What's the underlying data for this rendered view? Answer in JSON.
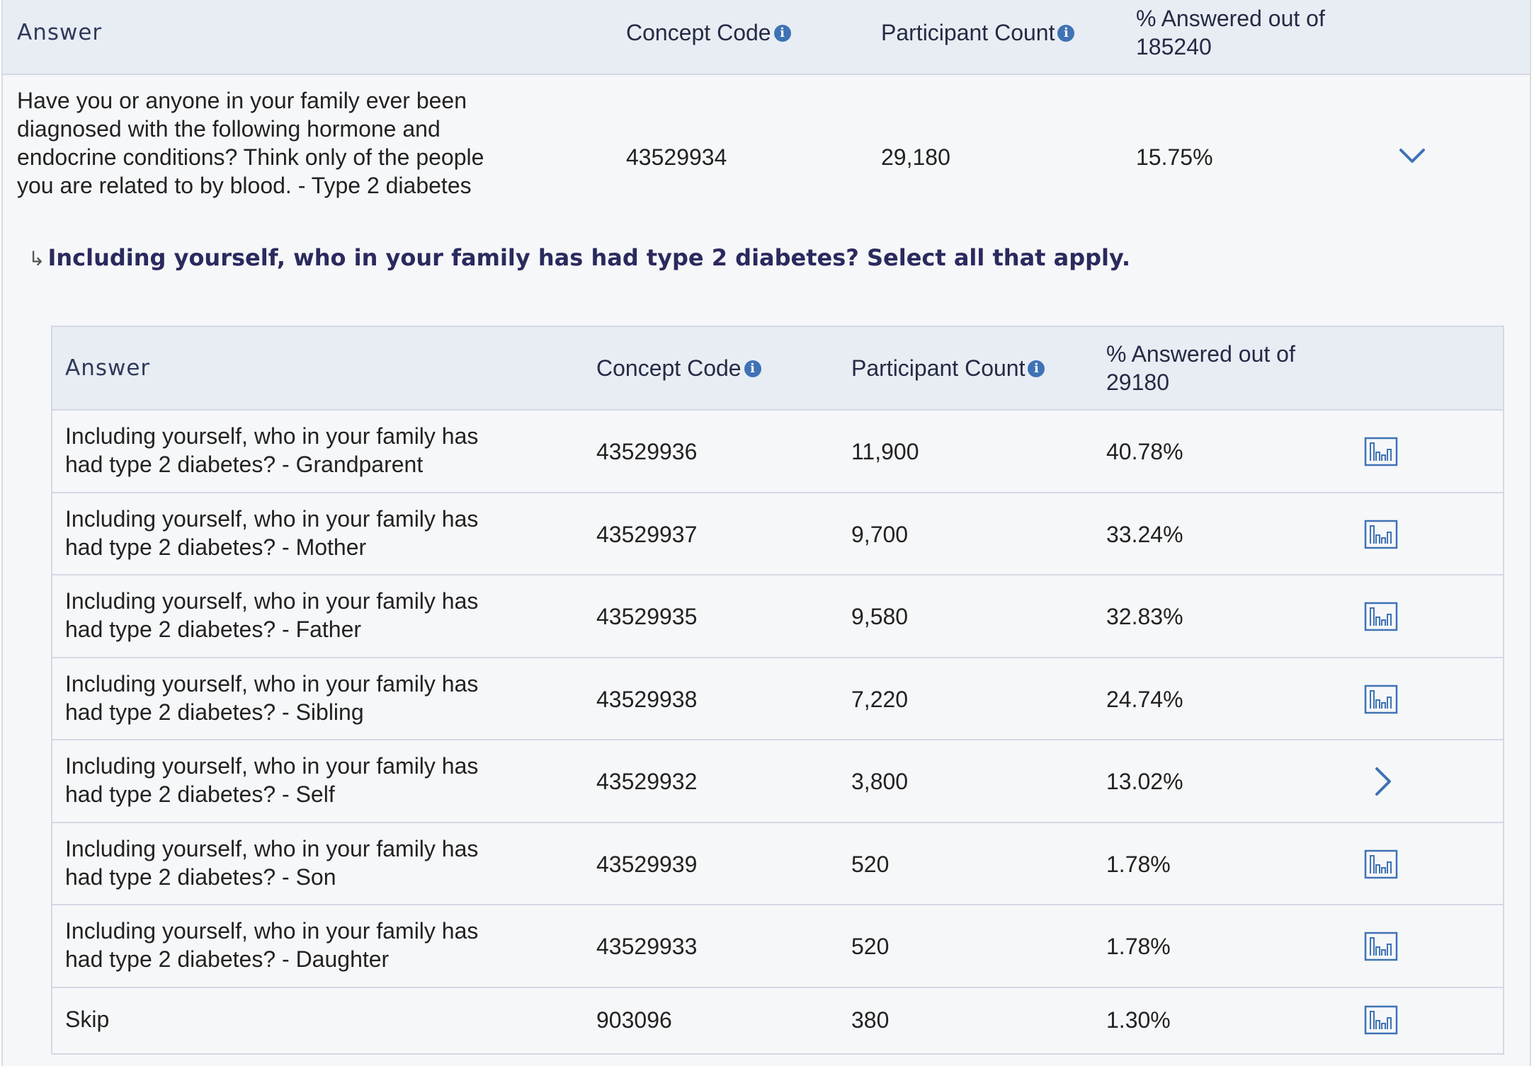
{
  "outer": {
    "header": {
      "answer": "Answer",
      "concept_code": "Concept Code",
      "participant_count": "Participant Count",
      "pct_line1": "% Answered out of",
      "pct_line2": "185240"
    },
    "question": {
      "text": "Have you or anyone in your family ever been diagnosed with the following hormone and endocrine conditions? Think only of the people you are related to by blood. - Type 2 diabetes",
      "concept_code": "43529934",
      "participant_count": "29,180",
      "percent": "15.75%"
    },
    "sub_question": {
      "arrow": "↳",
      "text": "Including yourself, who in your family has had type 2 diabetes? Select all that apply."
    }
  },
  "inner": {
    "header": {
      "answer": "Answer",
      "concept_code": "Concept Code",
      "participant_count": "Participant Count",
      "pct_line1": "% Answered out of",
      "pct_line2": "29180"
    },
    "rows": [
      {
        "line1": "Including yourself, who in your family has",
        "line2": "had type 2 diabetes? - Grandparent",
        "code": "43529936",
        "count": "11,900",
        "pct": "40.78%",
        "action": "chart-icon"
      },
      {
        "line1": "Including yourself, who in your family has",
        "line2": "had type 2 diabetes? - Mother",
        "code": "43529937",
        "count": "9,700",
        "pct": "33.24%",
        "action": "chart-icon"
      },
      {
        "line1": "Including yourself, who in your family has",
        "line2": "had type 2 diabetes? - Father",
        "code": "43529935",
        "count": "9,580",
        "pct": "32.83%",
        "action": "chart-icon"
      },
      {
        "line1": "Including yourself, who in your family has",
        "line2": "had type 2 diabetes? - Sibling",
        "code": "43529938",
        "count": "7,220",
        "pct": "24.74%",
        "action": "chart-icon"
      },
      {
        "line1": "Including yourself, who in your family has",
        "line2": "had type 2 diabetes? - Self",
        "code": "43529932",
        "count": "3,800",
        "pct": "13.02%",
        "action": "chevron-right-icon"
      },
      {
        "line1": "Including yourself, who in your family has",
        "line2": "had type 2 diabetes? - Son",
        "code": "43529939",
        "count": "520",
        "pct": "1.78%",
        "action": "chart-icon"
      },
      {
        "line1": "Including yourself, who in your family has",
        "line2": "had type 2 diabetes? - Daughter",
        "code": "43529933",
        "count": "520",
        "pct": "1.78%",
        "action": "chart-icon"
      },
      {
        "line1": "Skip",
        "line2": "",
        "code": "903096",
        "count": "380",
        "pct": "1.30%",
        "action": "chart-icon"
      }
    ]
  },
  "colors": {
    "accent": "#3f72b5",
    "header_bg": "#e8edf4",
    "sub_question_text": "#2a2a5e"
  },
  "icons": {
    "info": "i"
  }
}
